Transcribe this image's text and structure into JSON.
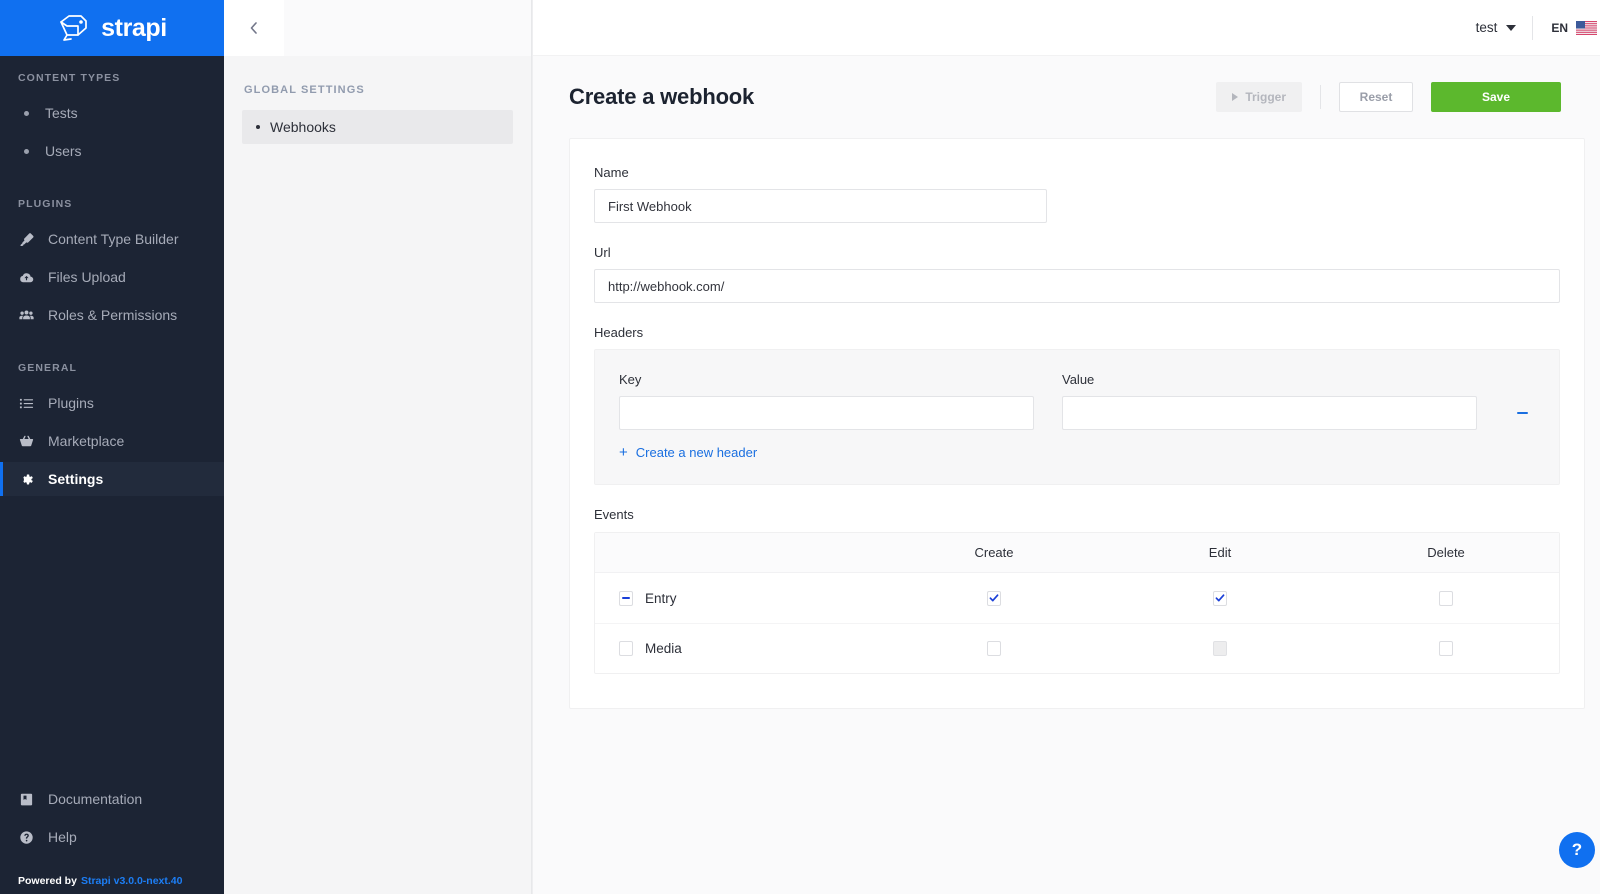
{
  "brand": {
    "name": "strapi",
    "logo_icon": "strapi-logo-icon"
  },
  "sidebar": {
    "sections": [
      {
        "title": "CONTENT TYPES",
        "items": [
          {
            "label": "Tests",
            "icon": "dot-icon"
          },
          {
            "label": "Users",
            "icon": "dot-icon"
          }
        ]
      },
      {
        "title": "PLUGINS",
        "items": [
          {
            "label": "Content Type Builder",
            "icon": "paintbrush-icon"
          },
          {
            "label": "Files Upload",
            "icon": "cloud-upload-icon"
          },
          {
            "label": "Roles & Permissions",
            "icon": "users-group-icon"
          }
        ]
      },
      {
        "title": "GENERAL",
        "items": [
          {
            "label": "Plugins",
            "icon": "list-icon"
          },
          {
            "label": "Marketplace",
            "icon": "shopping-basket-icon"
          },
          {
            "label": "Settings",
            "icon": "gear-icon"
          }
        ]
      }
    ],
    "bottom_items": [
      {
        "label": "Documentation",
        "icon": "book-icon"
      },
      {
        "label": "Help",
        "icon": "question-circle-icon"
      }
    ],
    "footer": {
      "prefix": "Powered by",
      "version_link": "Strapi v3.0.0-next.40"
    }
  },
  "subnav": {
    "back_icon": "chevron-left-icon",
    "title": "GLOBAL SETTINGS",
    "items": [
      {
        "label": "Webhooks"
      }
    ]
  },
  "topbar": {
    "user": "test",
    "user_caret_icon": "chevron-down-icon",
    "language": "EN",
    "flag_icon": "us-flag-icon"
  },
  "page": {
    "title": "Create a webhook",
    "trigger_label": "Trigger",
    "trigger_icon": "play-icon",
    "reset_label": "Reset",
    "save_label": "Save"
  },
  "form": {
    "name": {
      "label": "Name",
      "value": "First Webhook",
      "placeholder": ""
    },
    "url": {
      "label": "Url",
      "value": "http://webhook.com/",
      "placeholder": ""
    },
    "headers": {
      "label": "Headers",
      "key_label": "Key",
      "value_label": "Value",
      "key_value": "",
      "value_value": "",
      "remove_icon": "minus-circle-icon",
      "add_label": "Create a new header",
      "add_icon": "plus-icon"
    },
    "events": {
      "label": "Events",
      "columns": [
        "Create",
        "Edit",
        "Delete"
      ],
      "rows": [
        {
          "name": "Entry",
          "state": "indeterminate",
          "checks": [
            "checked",
            "checked",
            "unchecked"
          ]
        },
        {
          "name": "Media",
          "state": "unchecked",
          "checks": [
            "unchecked",
            "hover",
            "unchecked"
          ]
        }
      ]
    }
  },
  "help": {
    "label": "?",
    "icon": "question-icon"
  },
  "colors": {
    "brand_blue": "#1070f0",
    "sidebar_dark": "#1c2434",
    "save_green": "#5cb82d",
    "link_blue": "#1a6fe0",
    "check_blue": "#1a3fd8"
  }
}
